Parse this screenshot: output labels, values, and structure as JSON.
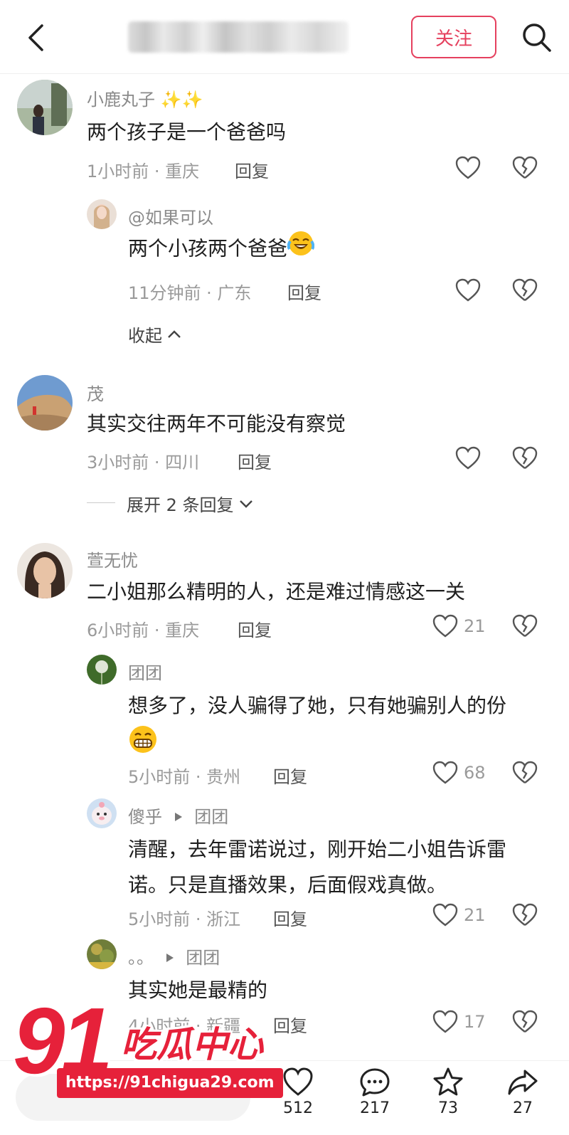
{
  "header": {
    "back_icon": "back-arrow-icon",
    "title": "",
    "follow_label": "关注",
    "search_icon": "search-icon",
    "accent_color": "#e5405e"
  },
  "comments": [
    {
      "username": "小鹿丸子 ✨✨",
      "text": "两个孩子是一个爸爸吗",
      "meta": "1小时前 · 重庆",
      "reply_label": "回复",
      "like_count": "",
      "replies": [
        {
          "username": "@如果可以",
          "text": "两个小孩两个爸爸",
          "emoji": "laughing-crying-emoji",
          "meta": "11分钟前 · 广东",
          "reply_label": "回复",
          "like_count": ""
        }
      ],
      "collapse_label": "收起"
    },
    {
      "username": "茂",
      "text": "其实交往两年不可能没有察觉",
      "meta": "3小时前 · 四川",
      "reply_label": "回复",
      "like_count": "",
      "expand_label": "展开 2 条回复"
    },
    {
      "username": "萱无忧",
      "text": "二小姐那么精明的人，还是难过情感这一关",
      "meta": "6小时前 · 重庆",
      "reply_label": "回复",
      "like_count": "21",
      "replies": [
        {
          "username": "团团",
          "text": "想多了，没人骗得了她，只有她骗别人的份",
          "emoji": "grinning-emoji",
          "meta": "5小时前 · 贵州",
          "reply_label": "回复",
          "like_count": "68"
        },
        {
          "username": "傻乎",
          "reply_to": "团团",
          "text_line1": "清醒，去年雷诺说过，刚开始二小姐告诉雷",
          "text_line2": "诺。只是直播效果，后面假戏真做。",
          "meta": "5小时前 · 浙江",
          "reply_label": "回复",
          "like_count": "21"
        },
        {
          "username": "。。",
          "reply_to": "团团",
          "text": "其实她是最精的",
          "meta": "4小时前 · 新疆",
          "reply_label": "回复",
          "like_count": "17"
        }
      ]
    }
  ],
  "bottom_bar": {
    "likes": "512",
    "comments": "217",
    "favorites": "73",
    "shares": "27"
  },
  "watermark": {
    "number": "91",
    "name": "吃瓜中心",
    "url": "https://91chigua29.com"
  }
}
